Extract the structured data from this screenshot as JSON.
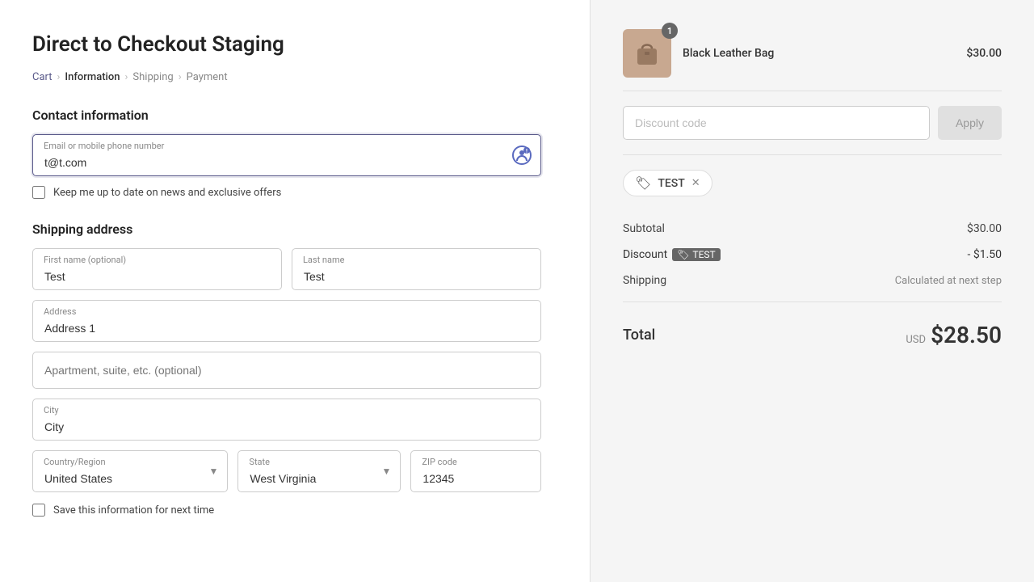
{
  "page": {
    "title": "Direct to Checkout Staging"
  },
  "breadcrumb": {
    "items": [
      {
        "label": "Cart",
        "active": false
      },
      {
        "label": "Information",
        "active": true
      },
      {
        "label": "Shipping",
        "active": false
      },
      {
        "label": "Payment",
        "active": false
      }
    ]
  },
  "contact": {
    "section_title": "Contact information",
    "email_label": "Email or mobile phone number",
    "email_value": "t@t.com",
    "newsletter_label": "Keep me up to date on news and exclusive offers"
  },
  "shipping": {
    "section_title": "Shipping address",
    "first_name_label": "First name (optional)",
    "first_name_value": "Test",
    "last_name_label": "Last name",
    "last_name_value": "Test",
    "address_label": "Address",
    "address_value": "Address 1",
    "address2_placeholder": "Apartment, suite, etc. (optional)",
    "city_label": "City",
    "city_value": "City",
    "country_label": "Country/Region",
    "country_value": "United States",
    "state_label": "State",
    "state_value": "West Virginia",
    "zip_label": "ZIP code",
    "zip_value": "12345",
    "save_label": "Save this information for next time"
  },
  "order": {
    "product_name": "Black Leather Bag",
    "product_price": "$30.00",
    "product_badge": "1",
    "discount_placeholder": "Discount code",
    "apply_label": "Apply",
    "applied_code": "TEST",
    "subtotal_label": "Subtotal",
    "subtotal_value": "$30.00",
    "discount_label": "Discount",
    "discount_code_badge": "TEST",
    "discount_value": "- $1.50",
    "shipping_label": "Shipping",
    "shipping_value": "Calculated at next step",
    "total_label": "Total",
    "total_currency": "USD",
    "total_value": "$28.50"
  }
}
